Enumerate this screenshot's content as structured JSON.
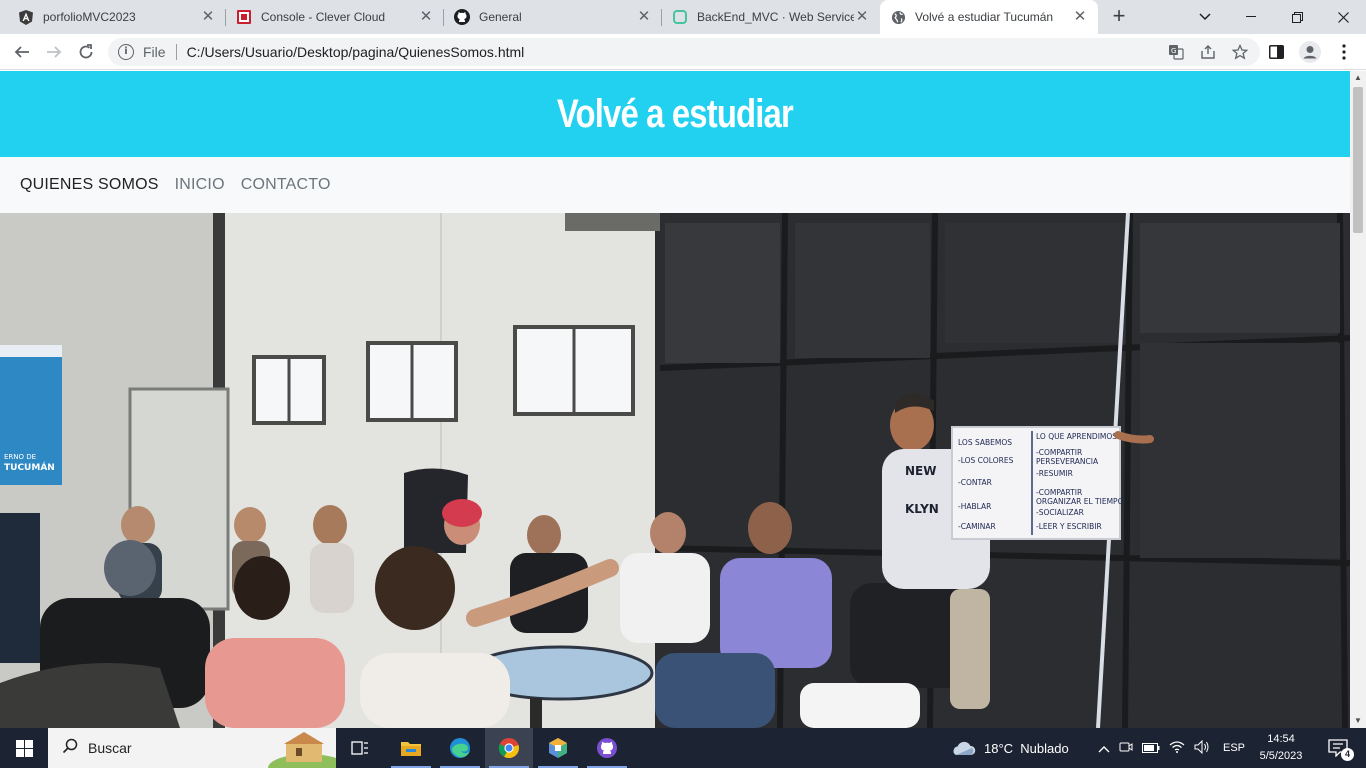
{
  "browser": {
    "tabs": [
      {
        "title": "porfolioMVC2023",
        "icon": "angular-icon",
        "active": false
      },
      {
        "title": "Console - Clever Cloud",
        "icon": "clever-cloud-icon",
        "active": false
      },
      {
        "title": "General",
        "icon": "github-icon",
        "active": false
      },
      {
        "title": "BackEnd_MVC · Web Service",
        "icon": "render-icon",
        "active": false
      },
      {
        "title": "Volvé a estudiar Tucumán",
        "icon": "globe-icon",
        "active": true
      }
    ],
    "address": {
      "scheme_label": "File",
      "url": "C:/Users/Usuario/Desktop/pagina/QuienesSomos.html"
    }
  },
  "site": {
    "title": "Volvé a estudiar",
    "nav": [
      {
        "label": "QUIENES SOMOS",
        "active": true
      },
      {
        "label": "INICIO",
        "active": false
      },
      {
        "label": "CONTACTO",
        "active": false
      }
    ],
    "hero": {
      "left_banner_text": "ERNO DE\nTUCUMÁN",
      "flipchart_left": [
        "LOS SABEMOS",
        "LOS COLORES",
        "CONTAR",
        "HABLAR",
        "CAMINAR"
      ],
      "flipchart_right": [
        "LO QUE APRENDIMOS",
        "COMPARTIR",
        "PERSEVERANCIA",
        "RESUMIR",
        "COMPARTIR",
        "ORGANIZAR EL TIEMPO",
        "SOCIALIZAR",
        "LEER Y ESCRIBIR"
      ],
      "shirt_text": "NEW YORK BROOKLYN"
    },
    "colors": {
      "header_bg": "#22d1f0",
      "nav_bg": "#f8f9fa"
    }
  },
  "taskbar": {
    "search_placeholder": "Buscar",
    "weather": "18°C  Nublado",
    "language": "ESP",
    "time": "14:54",
    "date": "5/5/2023",
    "notifications": "4",
    "apps": [
      "task-view-icon",
      "file-explorer-icon",
      "edge-icon",
      "chrome-icon",
      "generic-app-icon",
      "github-desktop-icon"
    ]
  }
}
